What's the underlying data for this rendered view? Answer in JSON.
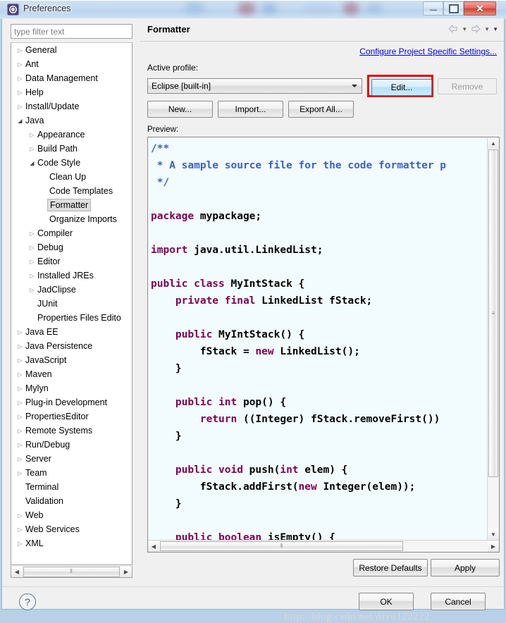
{
  "window": {
    "title": "Preferences",
    "icon": "eclipse-gear-icon",
    "controls": {
      "minimize": "minimize-icon",
      "maximize": "maximize-icon",
      "close": "close-icon"
    }
  },
  "sidebar": {
    "filter_placeholder": "type filter text",
    "filter_value": "",
    "items": [
      {
        "label": "General",
        "indent": 0,
        "state": "collapsed"
      },
      {
        "label": "Ant",
        "indent": 0,
        "state": "collapsed"
      },
      {
        "label": "Data Management",
        "indent": 0,
        "state": "collapsed"
      },
      {
        "label": "Help",
        "indent": 0,
        "state": "collapsed"
      },
      {
        "label": "Install/Update",
        "indent": 0,
        "state": "collapsed"
      },
      {
        "label": "Java",
        "indent": 0,
        "state": "expanded"
      },
      {
        "label": "Appearance",
        "indent": 1,
        "state": "collapsed"
      },
      {
        "label": "Build Path",
        "indent": 1,
        "state": "collapsed"
      },
      {
        "label": "Code Style",
        "indent": 1,
        "state": "expanded"
      },
      {
        "label": "Clean Up",
        "indent": 2,
        "state": "leaf"
      },
      {
        "label": "Code Templates",
        "indent": 2,
        "state": "leaf"
      },
      {
        "label": "Formatter",
        "indent": 2,
        "state": "leaf",
        "selected": true
      },
      {
        "label": "Organize Imports",
        "indent": 2,
        "state": "leaf"
      },
      {
        "label": "Compiler",
        "indent": 1,
        "state": "collapsed"
      },
      {
        "label": "Debug",
        "indent": 1,
        "state": "collapsed"
      },
      {
        "label": "Editor",
        "indent": 1,
        "state": "collapsed"
      },
      {
        "label": "Installed JREs",
        "indent": 1,
        "state": "collapsed"
      },
      {
        "label": "JadClipse",
        "indent": 1,
        "state": "collapsed"
      },
      {
        "label": "JUnit",
        "indent": 1,
        "state": "leaf"
      },
      {
        "label": "Properties Files Edito",
        "indent": 1,
        "state": "leaf"
      },
      {
        "label": "Java EE",
        "indent": 0,
        "state": "collapsed"
      },
      {
        "label": "Java Persistence",
        "indent": 0,
        "state": "collapsed"
      },
      {
        "label": "JavaScript",
        "indent": 0,
        "state": "collapsed"
      },
      {
        "label": "Maven",
        "indent": 0,
        "state": "collapsed"
      },
      {
        "label": "Mylyn",
        "indent": 0,
        "state": "collapsed"
      },
      {
        "label": "Plug-in Development",
        "indent": 0,
        "state": "collapsed"
      },
      {
        "label": "PropertiesEditor",
        "indent": 0,
        "state": "collapsed"
      },
      {
        "label": "Remote Systems",
        "indent": 0,
        "state": "collapsed"
      },
      {
        "label": "Run/Debug",
        "indent": 0,
        "state": "collapsed"
      },
      {
        "label": "Server",
        "indent": 0,
        "state": "collapsed"
      },
      {
        "label": "Team",
        "indent": 0,
        "state": "collapsed"
      },
      {
        "label": "Terminal",
        "indent": 0,
        "state": "leaf"
      },
      {
        "label": "Validation",
        "indent": 0,
        "state": "leaf"
      },
      {
        "label": "Web",
        "indent": 0,
        "state": "collapsed"
      },
      {
        "label": "Web Services",
        "indent": 0,
        "state": "collapsed"
      },
      {
        "label": "XML",
        "indent": 0,
        "state": "collapsed"
      }
    ]
  },
  "panel": {
    "title": "Formatter",
    "configure_link": "Configure Project Specific Settings...",
    "active_profile_label": "Active profile:",
    "profile_value": "Eclipse [built-in]",
    "edit_button": "Edit...",
    "remove_button": "Remove",
    "new_button": "New...",
    "import_button": "Import...",
    "export_all_button": "Export All...",
    "preview_label": "Preview:",
    "restore_defaults_button": "Restore Defaults",
    "apply_button": "Apply",
    "highlight_color": "#e60000",
    "nav": {
      "back": "back-arrow-icon",
      "back_menu": "back-dropdown-icon",
      "forward": "forward-arrow-icon",
      "forward_menu": "forward-dropdown-icon",
      "menu": "view-menu-icon"
    }
  },
  "preview_code": {
    "language": "java",
    "colors": {
      "comment": "#3f5fbf",
      "keyword": "#7f0055",
      "text": "#000000",
      "background": "#f2fbfd"
    },
    "lines": [
      [
        {
          "t": "/**",
          "c": "cmt"
        }
      ],
      [
        {
          "t": " * A sample source file for the code formatter p",
          "c": "cmt"
        }
      ],
      [
        {
          "t": " */",
          "c": "cmt"
        }
      ],
      [
        {
          "t": "",
          "c": "txt"
        }
      ],
      [
        {
          "t": "package",
          "c": "kw"
        },
        {
          "t": " mypackage;",
          "c": "txt"
        }
      ],
      [
        {
          "t": "",
          "c": "txt"
        }
      ],
      [
        {
          "t": "import",
          "c": "kw"
        },
        {
          "t": " java.util.LinkedList;",
          "c": "txt"
        }
      ],
      [
        {
          "t": "",
          "c": "txt"
        }
      ],
      [
        {
          "t": "public class",
          "c": "kw"
        },
        {
          "t": " MyIntStack {",
          "c": "txt"
        }
      ],
      [
        {
          "t": "    ",
          "c": "txt"
        },
        {
          "t": "private final",
          "c": "kw"
        },
        {
          "t": " LinkedList fStack;",
          "c": "txt"
        }
      ],
      [
        {
          "t": "",
          "c": "txt"
        }
      ],
      [
        {
          "t": "    ",
          "c": "txt"
        },
        {
          "t": "public",
          "c": "kw"
        },
        {
          "t": " MyIntStack() {",
          "c": "txt"
        }
      ],
      [
        {
          "t": "        fStack = ",
          "c": "txt"
        },
        {
          "t": "new",
          "c": "kw"
        },
        {
          "t": " LinkedList();",
          "c": "txt"
        }
      ],
      [
        {
          "t": "    }",
          "c": "txt"
        }
      ],
      [
        {
          "t": "",
          "c": "txt"
        }
      ],
      [
        {
          "t": "    ",
          "c": "txt"
        },
        {
          "t": "public int",
          "c": "kw"
        },
        {
          "t": " pop() {",
          "c": "txt"
        }
      ],
      [
        {
          "t": "        ",
          "c": "txt"
        },
        {
          "t": "return",
          "c": "kw"
        },
        {
          "t": " ((Integer) fStack.removeFirst())",
          "c": "txt"
        }
      ],
      [
        {
          "t": "    }",
          "c": "txt"
        }
      ],
      [
        {
          "t": "",
          "c": "txt"
        }
      ],
      [
        {
          "t": "    ",
          "c": "txt"
        },
        {
          "t": "public void",
          "c": "kw"
        },
        {
          "t": " push(",
          "c": "txt"
        },
        {
          "t": "int",
          "c": "kw"
        },
        {
          "t": " elem) {",
          "c": "txt"
        }
      ],
      [
        {
          "t": "        fStack.addFirst(",
          "c": "txt"
        },
        {
          "t": "new",
          "c": "kw"
        },
        {
          "t": " Integer(elem));",
          "c": "txt"
        }
      ],
      [
        {
          "t": "    }",
          "c": "txt"
        }
      ],
      [
        {
          "t": "",
          "c": "txt"
        }
      ],
      [
        {
          "t": "    ",
          "c": "txt"
        },
        {
          "t": "public boolean",
          "c": "kw"
        },
        {
          "t": " isEmpty() {",
          "c": "txt"
        }
      ]
    ]
  },
  "footer": {
    "help": "help-icon",
    "ok_button": "OK",
    "cancel_button": "Cancel"
  },
  "watermark": "http://blog.csdn.net/diyu122222"
}
